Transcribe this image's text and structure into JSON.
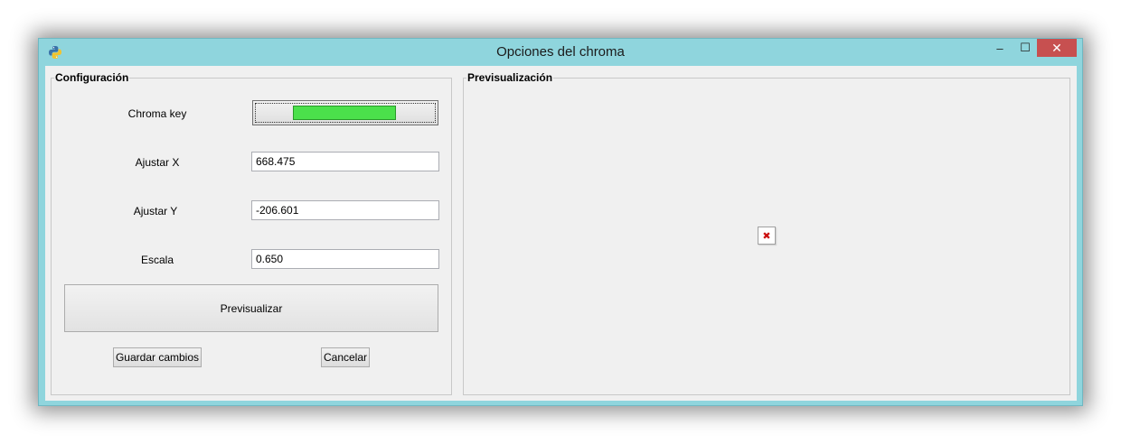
{
  "window": {
    "title": "Opciones del chroma",
    "controls": {
      "minimize": "‒",
      "maximize": "☐",
      "close": "✕"
    }
  },
  "config": {
    "legend": "Configuración",
    "chroma_label": "Chroma key",
    "chroma_color": "#4be04b",
    "x_label": "Ajustar X",
    "x_value": "668.475",
    "y_label": "Ajustar Y",
    "y_value": "-206.601",
    "scale_label": "Escala",
    "scale_value": "0.650",
    "preview_button": "Previsualizar",
    "save_button": "Guardar cambios",
    "cancel_button": "Cancelar"
  },
  "preview": {
    "legend": "Previsualización",
    "placeholder_icon": "broken-image-icon",
    "placeholder_glyph": "✖"
  }
}
